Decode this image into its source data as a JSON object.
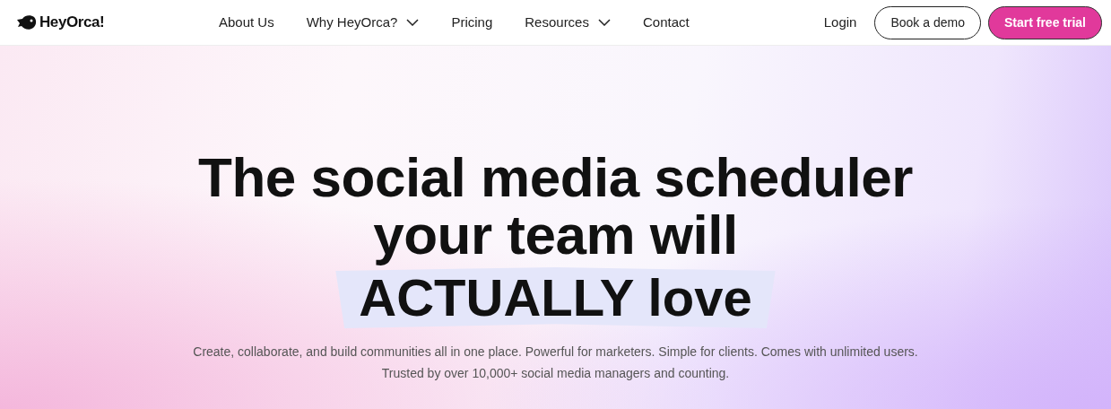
{
  "logo": {
    "text": "HeyOrca!"
  },
  "nav": [
    {
      "label": "About Us",
      "has_dropdown": false
    },
    {
      "label": "Why HeyOrca?",
      "has_dropdown": true
    },
    {
      "label": "Pricing",
      "has_dropdown": false
    },
    {
      "label": "Resources",
      "has_dropdown": true
    },
    {
      "label": "Contact",
      "has_dropdown": false
    }
  ],
  "actions": [
    {
      "label": "Login",
      "kind": "link"
    },
    {
      "label": "Book a demo",
      "kind": "outline"
    },
    {
      "label": "Start free trial",
      "kind": "primary"
    }
  ],
  "hero": {
    "headline_lines": [
      "The social media scheduler",
      "your team will"
    ],
    "highlight": "ACTUALLY love",
    "subtitle_lines": [
      "Create, collaborate, and build communities all in one place. Powerful for marketers. Simple for clients. Comes with unlimited users.",
      "Trusted by over 10,000+ social media managers and counting."
    ]
  }
}
